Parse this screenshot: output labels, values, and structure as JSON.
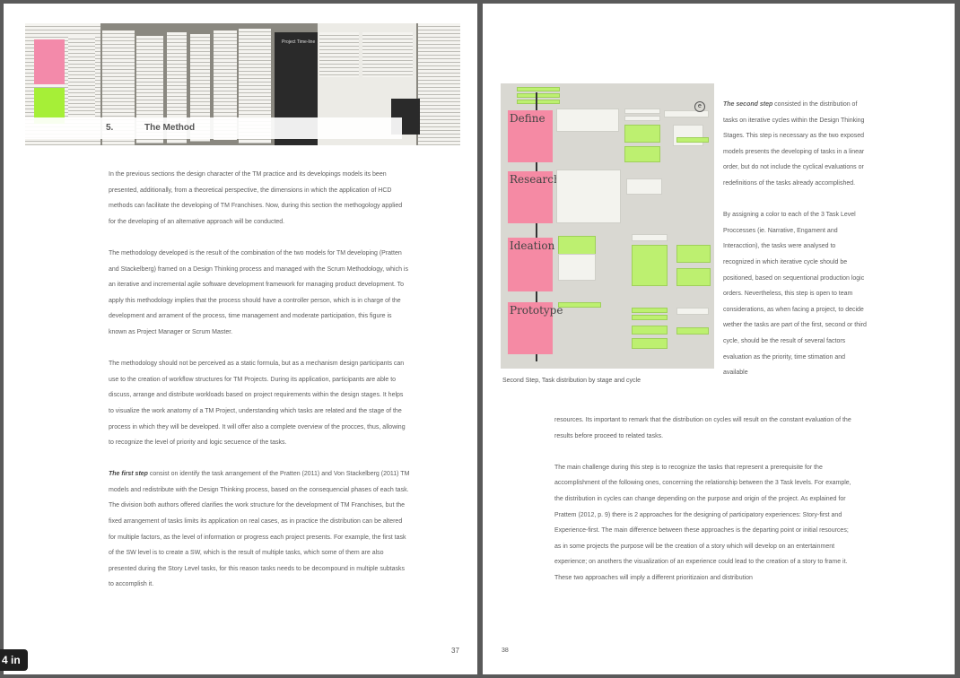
{
  "left_page": {
    "section_number": "5.",
    "section_title": "The Method",
    "banner_label": "Project Time-line",
    "paragraphs": [
      "In the previous sections the design character of the TM practice and its developings models its been presented, additionally, from a theoretical perspective, the dimensions in which the application of HCD methods can facilitate the developing of TM Franchises. Now, during this section the methogology applied for the developing of an alternative approach will be conducted.",
      "The methodology developed is the result of the combination of the two models for TM developing (Pratten and Stackelberg) framed on a Design Thinking process and managed with the Scrum Methodology, which is an iterative and incremental agile software development framework for managing product development. To apply this methodology implies that the process should have a controller person, which is in charge of the development and arrament of the process, time management and moderate participation, this figure is known as Project Manager or Scrum Master.",
      "The methodology should not be perceived as a static formula, but as a mechanism design participants can use to the creation of workflow structures for TM Projects. During its application, participants are able to discuss, arrange and distribute workloads based on project requirements within the design stages. It helps to visualize the work anatomy of a TM Project, understanding which tasks are related and the stage of the process in which they will be developed. It will offer also a complete overview of the procces, thus, allowing to recognize the level of priority and logic secuence of the tasks."
    ],
    "first_step_lead": "The first step",
    "first_step_text": " consist on identify the task arrangement of the Pratten (2011) and Von Stackelberg (2011) TM models and redistribute with the Design Thinking process, based on the consequencial phases of each task. The division both authors offered clarifies the work structure for the development of TM Franchises, but the fixed arrangement of tasks limits its application on real cases, as in practice the distribution can be altered for multiple factors, as the level of information or progress each project presents. For example, the first task of the SW level is to create a SW, which is the result of multiple tasks, which some of them are also presented during the Story Level tasks, for this reason tasks needs to be decompound in multiple subtasks to accomplish it.",
    "page_number": "37"
  },
  "right_page": {
    "photo_labels": [
      "Define",
      "Research",
      "Ideation",
      "Prototype"
    ],
    "photo_header_cards": [
      "Narrative Design",
      "Engagement Design",
      "Interaction Design"
    ],
    "caption": "Second Step, Task distribution by stage and cycle",
    "second_step_lead": "The second step",
    "second_step_text": " consisted in the distribution of tasks on iterative cycles within the Design Thinking Stages. This step is necessary as the two exposed models presents the developing of tasks in a linear order, but do not include the cyclical evaluations or redefinitions of the tasks already accomplished.",
    "side_paragraph_2": "By assigning a color to each of the 3 Task Level Proccesses (ie. Narrative, Engament and Interacction), the tasks were analysed to recognized in which iterative cycle should be positioned, based on sequentional production logic orders. Nevertheless, this step is open to team considerations, as when facing a project, to decide wether the tasks are part of the first, second or third cycle, should be the result of several factors evaluation as the priority, time stimation and available",
    "continuation": "resources. Its important to remark that the distribution on cycles will result on the constant evaluation of the results before proceed to related tasks.",
    "paragraph_3": "The main challenge during this step is to recognize the tasks that represent a prerequisite for the accomplishment of the following ones, concerning the relationship between the 3 Task levels. For example, the distribution in cycles can change depending on the purpose and origin of the project. As explained for Prattem (2012, p. 9) there is 2 approaches for the designing of participatory experiences: Story-first and Experience-first. The main difference between these approaches is the departing point or initial resources; as in some projects the purpose will be the creation of a story which will develop on an entertainment experience; on anothers the visualization of an experience could lead to the creation of a story to frame it. These two approaches will imply a different prioritizaion and distribution",
    "page_number": "38"
  },
  "viewer": {
    "zoom_badge": "4 in"
  },
  "colors": {
    "sticky_pink": "#f58aa4",
    "sticky_green": "#a6ef37",
    "viewer_background": "#5a5a5a"
  }
}
